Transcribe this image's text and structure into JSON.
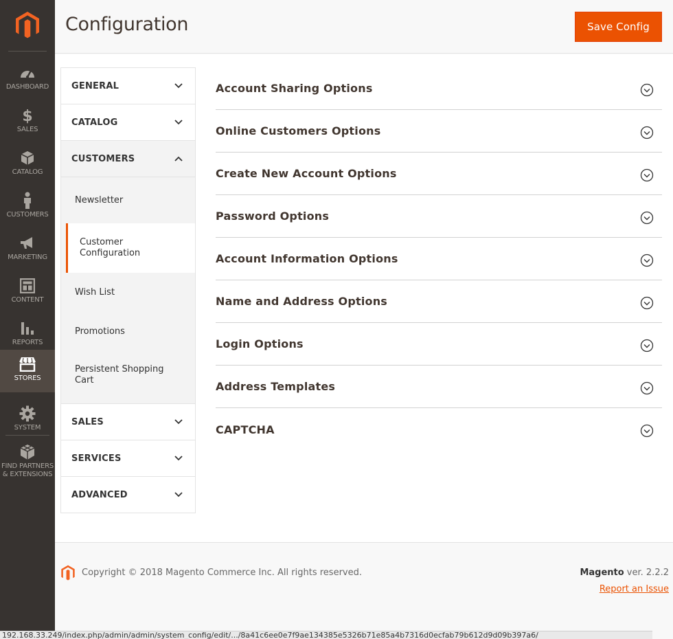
{
  "nav": {
    "items": [
      {
        "label": "DASHBOARD",
        "icon": "dashboard-icon"
      },
      {
        "label": "SALES",
        "icon": "dollar-icon"
      },
      {
        "label": "CATALOG",
        "icon": "box-icon"
      },
      {
        "label": "CUSTOMERS",
        "icon": "person-icon"
      },
      {
        "label": "MARKETING",
        "icon": "megaphone-icon"
      },
      {
        "label": "CONTENT",
        "icon": "layout-icon"
      },
      {
        "label": "REPORTS",
        "icon": "bar-chart-icon"
      },
      {
        "label": "STORES",
        "icon": "storefront-icon"
      },
      {
        "label": "SYSTEM",
        "icon": "gear-icon"
      },
      {
        "label": "FIND PARTNERS & EXTENSIONS",
        "icon": "blocks-icon"
      }
    ],
    "active": "STORES"
  },
  "header": {
    "title": "Configuration",
    "save_label": "Save Config"
  },
  "tabs": {
    "general": "GENERAL",
    "catalog": "CATALOG",
    "customers": "CUSTOMERS",
    "customers_items": [
      "Newsletter",
      "Customer Configuration",
      "Wish List",
      "Promotions",
      "Persistent Shopping Cart"
    ],
    "active_item": "Customer Configuration",
    "sales": "SALES",
    "services": "SERVICES",
    "advanced": "ADVANCED"
  },
  "sections": [
    "Account Sharing Options",
    "Online Customers Options",
    "Create New Account Options",
    "Password Options",
    "Account Information Options",
    "Name and Address Options",
    "Login Options",
    "Address Templates",
    "CAPTCHA"
  ],
  "footer": {
    "copyright": "Copyright © 2018 Magento Commerce Inc. All rights reserved.",
    "brand": "Magento",
    "version": " ver. 2.2.2",
    "report": "Report an Issue"
  },
  "statusbar": {
    "url": "192.168.33.249/index.php/admin/admin/system_config/edit/.../8a41c6ee0e7f9ae134385e5326b71e85a4b7316d0ecfab79b612d9d09b397a6/"
  },
  "colors": {
    "accent": "#eb5202",
    "nav_bg": "#373330",
    "nav_active": "#514943"
  }
}
